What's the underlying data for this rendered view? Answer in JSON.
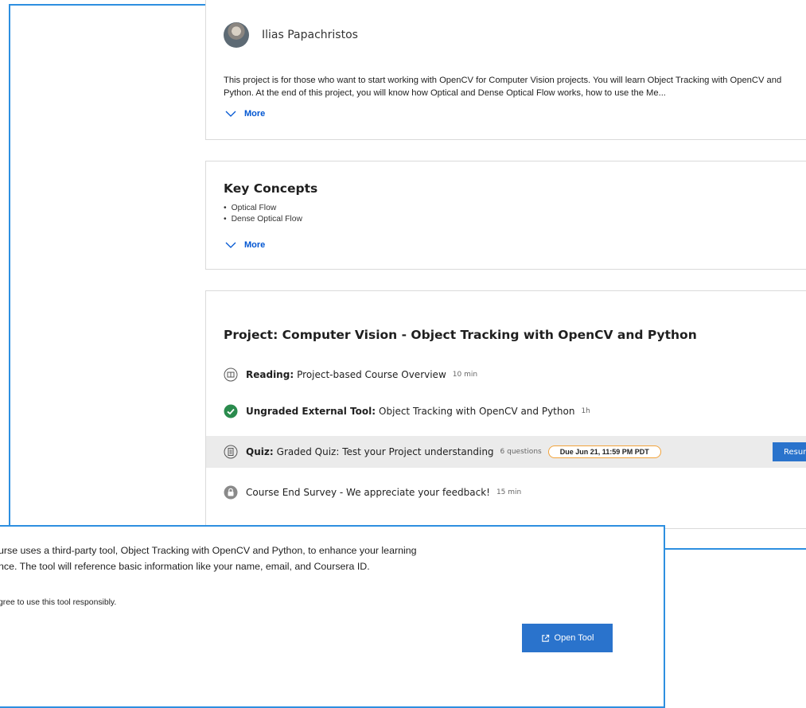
{
  "author": {
    "name": "Ilias Papachristos"
  },
  "description": {
    "line1": "This project is for those who want to start working with OpenCV for Computer Vision projects. You will learn Object Tracking with OpenCV and",
    "line2": "Python. At the end of this project, you will know how Optical and Dense Optical Flow works, how to use the Me...",
    "more_label": "More"
  },
  "key_concepts": {
    "title": "Key Concepts",
    "items": [
      "Optical Flow",
      "Dense Optical Flow"
    ],
    "more_label": "More"
  },
  "project": {
    "title": "Project: Computer Vision - Object Tracking with OpenCV and Python",
    "items": [
      {
        "type": "Reading:",
        "title": "Project-based Course Overview",
        "duration": "10 min",
        "icon": "book-icon"
      },
      {
        "type": "Ungraded External Tool:",
        "title": "Object Tracking with OpenCV and Python",
        "duration": "1h",
        "icon": "check-circle-icon"
      },
      {
        "type": "Quiz:",
        "title": "Graded Quiz: Test your Project understanding",
        "duration": "6 questions",
        "badge": "Due Jun 21, 11:59 PM PDT",
        "button": "Resume",
        "icon": "quiz-icon"
      },
      {
        "type": "",
        "title": "Course End Survey - We appreciate your feedback!",
        "duration": "15 min",
        "icon": "lock-icon"
      }
    ]
  },
  "modal": {
    "line1": "urse uses a third-party tool, Object Tracking with OpenCV and Python, to enhance your learning",
    "line2": "nce. The tool will reference basic information like your name, email, and Coursera ID.",
    "line3": "gree to use this tool responsibly.",
    "open_button": "Open Tool"
  },
  "colors": {
    "accent": "#0056d2",
    "button": "#2a73cc",
    "frame": "#2d8fe0",
    "badge_border": "#f2a33a",
    "success": "#2a8b4d"
  }
}
